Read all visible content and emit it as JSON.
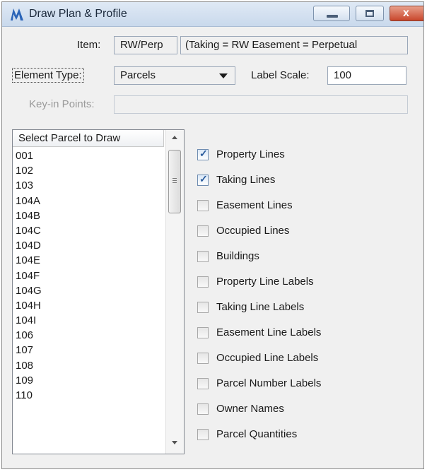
{
  "window": {
    "title": "Draw Plan & Profile",
    "close_glyph": "x"
  },
  "form": {
    "item_label": "Item:",
    "item_value": "RW/Perp",
    "item_desc": "(Taking = RW  Easement = Perpetual",
    "element_type_label": "Element Type:",
    "element_type_value": "Parcels",
    "label_scale_label": "Label Scale:",
    "label_scale_value": "100",
    "keyin_label": "Key-in Points:",
    "keyin_value": ""
  },
  "parcel_list": {
    "header": "Select Parcel to Draw",
    "items": [
      "001",
      "102",
      "103",
      "104A",
      "104B",
      "104C",
      "104D",
      "104E",
      "104F",
      "104G",
      "104H",
      "104I",
      "106",
      "107",
      "108",
      "109",
      "110"
    ]
  },
  "options": [
    {
      "label": "Property Lines",
      "checked": true
    },
    {
      "label": "Taking Lines",
      "checked": true
    },
    {
      "label": "Easement Lines",
      "checked": false
    },
    {
      "label": "Occupied Lines",
      "checked": false
    },
    {
      "label": "Buildings",
      "checked": false
    },
    {
      "label": "Property Line Labels",
      "checked": false
    },
    {
      "label": "Taking Line Labels",
      "checked": false
    },
    {
      "label": "Easement Line Labels",
      "checked": false
    },
    {
      "label": "Occupied Line Labels",
      "checked": false
    },
    {
      "label": "Parcel Number Labels",
      "checked": false
    },
    {
      "label": "Owner Names",
      "checked": false
    },
    {
      "label": "Parcel Quantities",
      "checked": false
    }
  ],
  "icons": {
    "app": "microstation-icon",
    "minimize": "minimize-icon",
    "maximize": "maximize-icon",
    "close": "close-icon",
    "dropdown": "chevron-down-icon",
    "checkmark": "checkmark-icon"
  },
  "colors": {
    "titlebar": "#c9d9ec",
    "close_button": "#c9462b",
    "check_accent": "#2a5b9c"
  }
}
